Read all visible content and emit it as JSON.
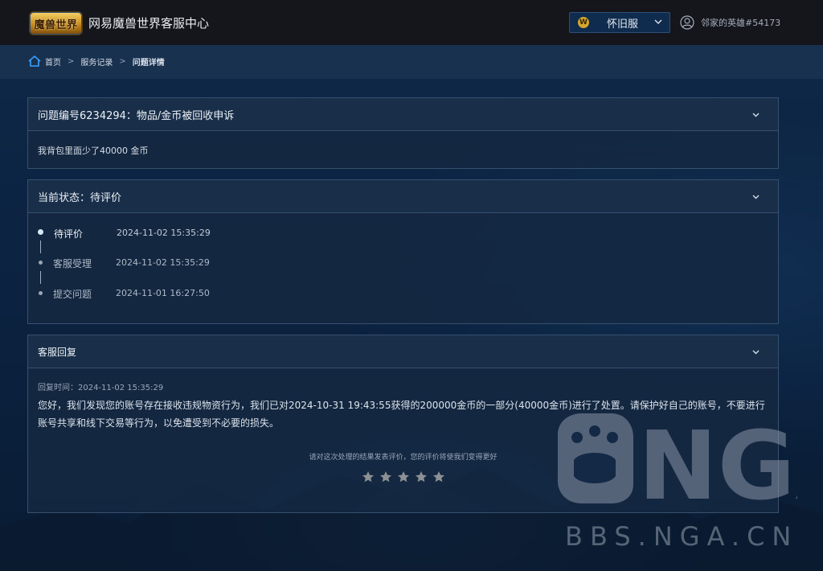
{
  "header": {
    "logo_text": "魔兽世界",
    "site_title": "网易魔兽世界客服中心",
    "server": "怀旧服",
    "username": "邻家的英雄#54173"
  },
  "breadcrumb": {
    "home": "首页",
    "service_records": "服务记录",
    "current": "问题详情"
  },
  "issue": {
    "title": "问题编号6234294：物品/金币被回收申诉",
    "description": "我背包里面少了40000 金币"
  },
  "status": {
    "title": "当前状态：待评价",
    "timeline": [
      {
        "label": "待评价",
        "time": "2024-11-02 15:35:29",
        "active": true
      },
      {
        "label": "客服受理",
        "time": "2024-11-02 15:35:29",
        "active": false
      },
      {
        "label": "提交问题",
        "time": "2024-11-01 16:27:50",
        "active": false
      }
    ]
  },
  "reply": {
    "title": "客服回复",
    "time": "回复时间：2024-11-02 15:35:29",
    "text": "您好，我们发现您的账号存在接收违规物资行为，我们已对2024-10-31 19:43:55获得的200000金币的一部分(40000金币)进行了处置。请保护好自己的账号，不要进行账号共享和线下交易等行为，以免遭受到不必要的损失。",
    "rating_hint": "请对这次处理的结果发表评价，您的评价将使我们变得更好",
    "rating": 0,
    "rating_max": 5
  },
  "watermark": {
    "logo": "NGA",
    "url": "BBS.NGA.CN"
  },
  "colors": {
    "topbar": "#14161b",
    "panel_border": "#37506e",
    "star": "#8d9094"
  }
}
